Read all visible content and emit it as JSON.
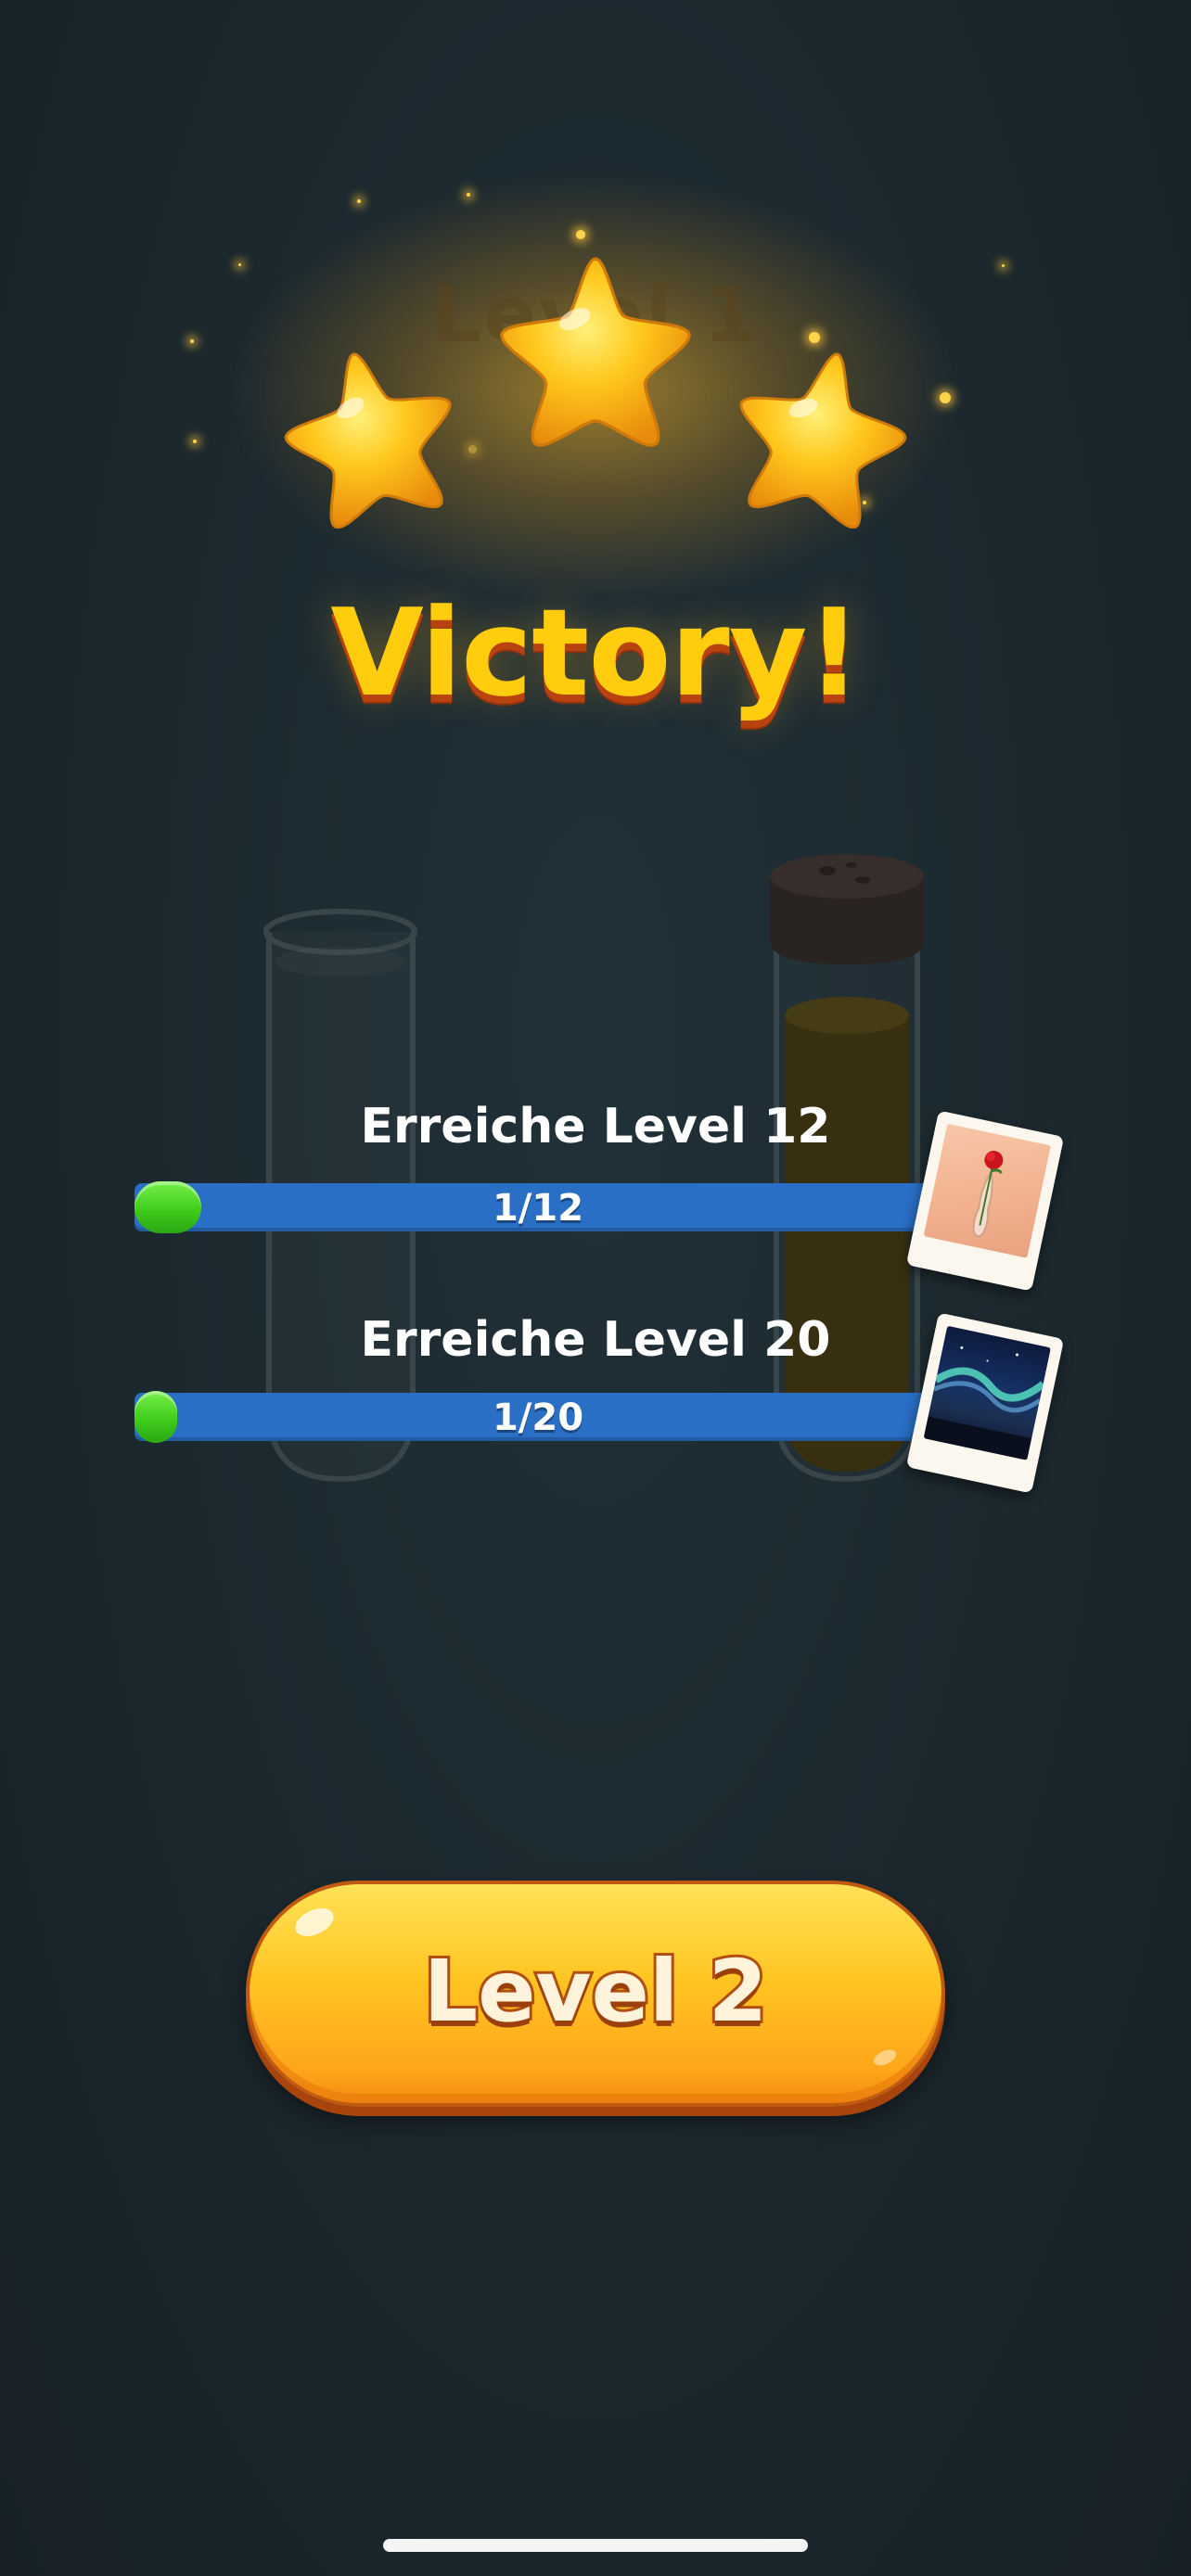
{
  "header": {
    "level_ghost_text": "Level 1",
    "stars_earned": 3,
    "stars_total": 3,
    "title": "Victory!"
  },
  "goals": [
    {
      "label": "Erreiche Level 12",
      "progress_text": "1/12",
      "current": 1,
      "target": 12,
      "reward_icon": "rose-vase-photo-icon"
    },
    {
      "label": "Erreiche Level 20",
      "progress_text": "1/20",
      "current": 1,
      "target": 20,
      "reward_icon": "aurora-photo-icon"
    }
  ],
  "actions": {
    "next_level_label": "Level 2"
  },
  "colors": {
    "background": "#1b282e",
    "title_yellow": "#ffcd0e",
    "star_gold": "#ffc21a",
    "bar_blue": "#2a6fc6",
    "progress_green": "#3fcd1c",
    "button_orange": "#ffc421"
  }
}
